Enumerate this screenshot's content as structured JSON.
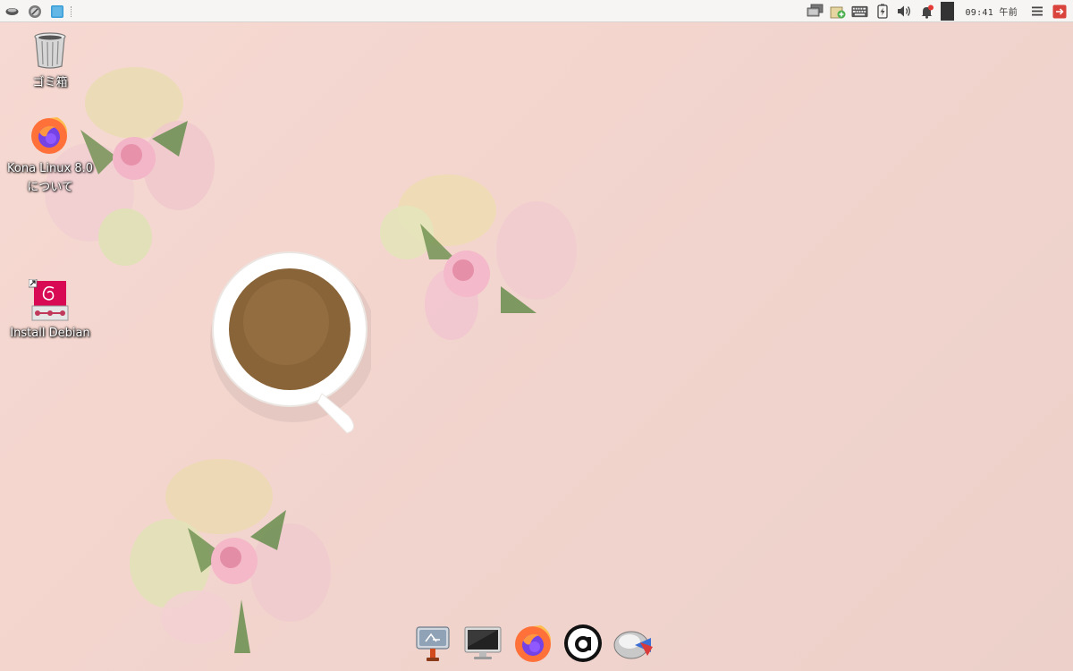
{
  "panel": {
    "clock": "09:41 午前"
  },
  "desktop_icons": [
    {
      "label": "ゴミ箱"
    },
    {
      "label": "Kona Linux 8.0について"
    },
    {
      "label": "Install Debian"
    }
  ],
  "colors": {
    "wallpaper": "#f3d5ce",
    "panel": "#f7f5f3",
    "debian_red": "#d70a53",
    "firefox_orange": "#ff7139",
    "firefox_purple": "#7542e5"
  },
  "dock": {
    "items": [
      {
        "icon": "app-finder-icon"
      },
      {
        "icon": "monitor-icon"
      },
      {
        "icon": "firefox-icon"
      },
      {
        "icon": "at-sign-icon"
      },
      {
        "icon": "disk-usage-icon"
      }
    ]
  }
}
